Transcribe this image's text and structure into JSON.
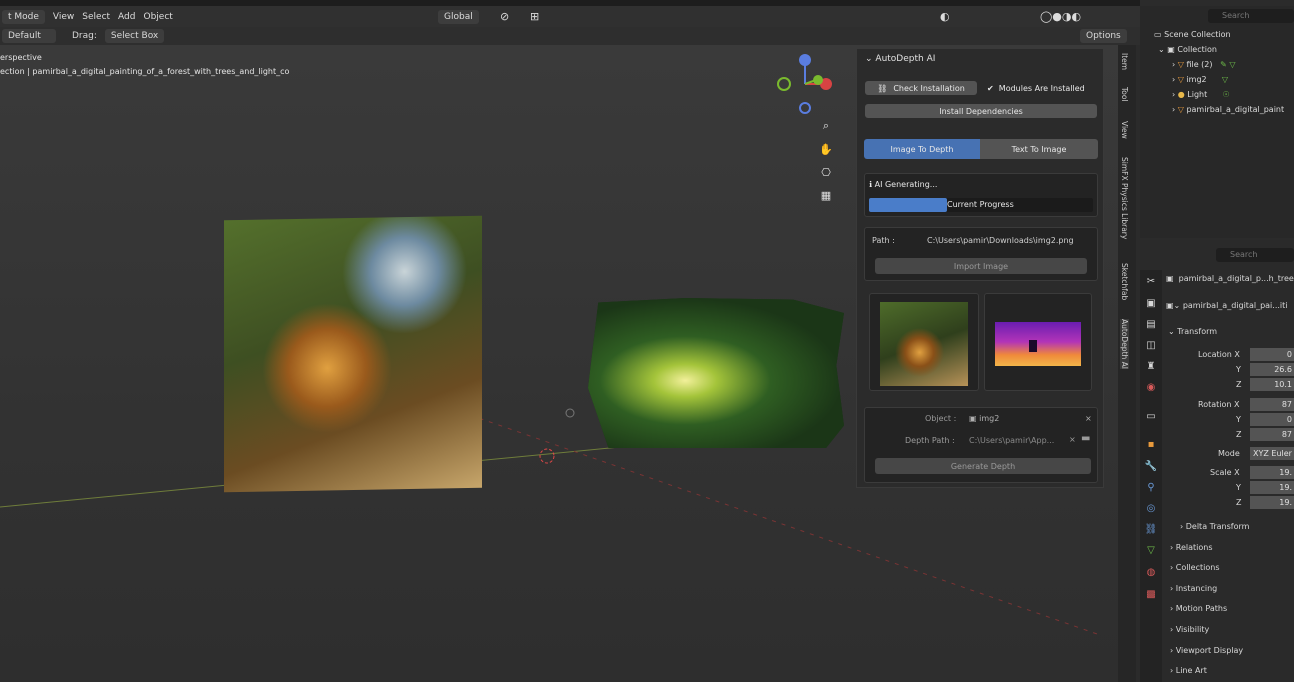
{
  "header": {
    "mode": "t Mode",
    "menu": [
      "View",
      "Select",
      "Add",
      "Object"
    ],
    "orientation": "Global",
    "orientation_label": "Default",
    "drag_label": "Drag:",
    "select_box": "Select Box",
    "options": "Options"
  },
  "viewport": {
    "line1": "erspective",
    "line2": "ection | pamirbal_a_digital_painting_of_a_forest_with_trees_and_light_co"
  },
  "panel": {
    "title": "AutoDepth AI",
    "check_installation": "Check Installation",
    "modules_installed": "Modules Are Installed",
    "install_deps": "Install Dependencies",
    "tab_image_to_depth": "Image To Depth",
    "tab_text_to_image": "Text To Image",
    "status": "AI Generating...",
    "progress_label": "Current Progress",
    "progress": 0.35,
    "path_label": "Path :",
    "path_value": "C:\\Users\\pamir\\Downloads\\img2.png",
    "import_image": "Import Image",
    "object_label": "Object :",
    "object_value": "img2",
    "depth_path_label": "Depth Path :",
    "depth_path_value": "C:\\Users\\pamir\\App...",
    "generate_depth": "Generate Depth"
  },
  "side_tabs": [
    "Item",
    "Tool",
    "View",
    "SimFX Physics Library",
    "Sketchfab",
    "AutoDepth AI"
  ],
  "outliner": {
    "search_placeholder": "Search",
    "scene_collection": "Scene Collection",
    "collection": "Collection",
    "items": [
      "file (2)",
      "img2",
      "Light",
      "pamirbal_a_digital_paint"
    ]
  },
  "properties": {
    "search_placeholder": "Search",
    "object_name": "pamirbal_a_digital_p...h_tree",
    "data_name": "pamirbal_a_digital_pai...iti",
    "transform": "Transform",
    "location_x_label": "Location X",
    "location": [
      "0",
      "26.6",
      "10.1"
    ],
    "rotation_x_label": "Rotation X",
    "rotation": [
      "87",
      "0",
      "87"
    ],
    "mode_label": "Mode",
    "mode_value": "XYZ Euler",
    "scale_x_label": "Scale X",
    "scale": [
      "19.",
      "19.",
      "19."
    ],
    "y_label": "Y",
    "z_label": "Z",
    "sections": [
      "Delta Transform",
      "Relations",
      "Collections",
      "Instancing",
      "Motion Paths",
      "Visibility",
      "Viewport Display",
      "Line Art"
    ]
  },
  "colors": {
    "accent": "#4772b3",
    "progress": "#4a7dc9"
  }
}
